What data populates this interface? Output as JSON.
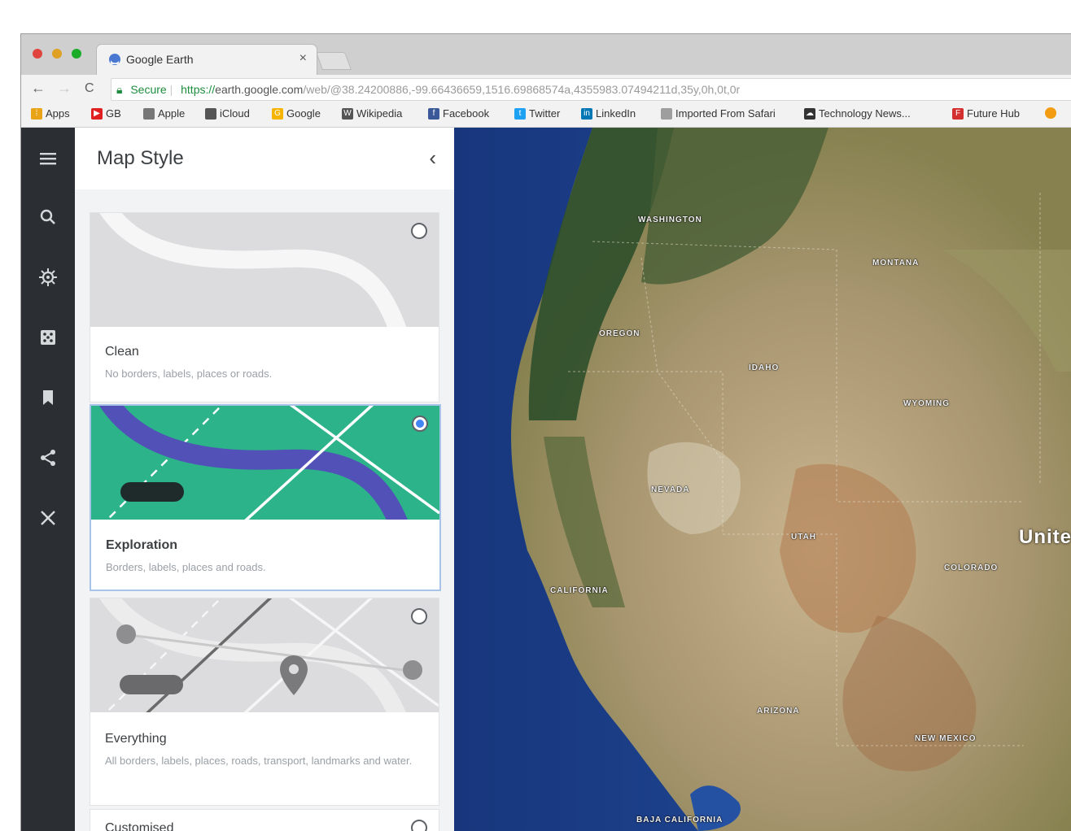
{
  "browser": {
    "tab_title": "Google Earth",
    "tab_close": "×",
    "secure_label": "Secure",
    "url_scheme": "https://",
    "url_host": "earth.google.com",
    "url_path": "/web/@38.24200886,-99.66436659,1516.69868574a,4355983.07494211d,35y,0h,0t,0r",
    "nav": {
      "back": "←",
      "forward": "→",
      "reload": "C"
    }
  },
  "bookmarks": [
    {
      "label": "Apps",
      "icon": "apps-grid-icon",
      "color": "#e8a317"
    },
    {
      "label": "GB",
      "icon": "youtube-icon",
      "color": "#e02020"
    },
    {
      "label": "Apple",
      "icon": "apple-icon",
      "color": "#777777"
    },
    {
      "label": "iCloud",
      "icon": "apple-icon",
      "color": "#555555"
    },
    {
      "label": "Google",
      "icon": "google-icon",
      "color": "#f4b400"
    },
    {
      "label": "Wikipedia",
      "icon": "wikipedia-icon",
      "color": "#555555"
    },
    {
      "label": "Facebook",
      "icon": "facebook-icon",
      "color": "#3b5998"
    },
    {
      "label": "Twitter",
      "icon": "twitter-icon",
      "color": "#1da1f2"
    },
    {
      "label": "LinkedIn",
      "icon": "linkedin-icon",
      "color": "#0077b5"
    },
    {
      "label": "Imported From Safari",
      "icon": "folder-icon",
      "color": "#9e9e9e"
    },
    {
      "label": "Technology News...",
      "icon": "cloud-icon",
      "color": "#333333"
    },
    {
      "label": "Future Hub",
      "icon": "future-icon",
      "color": "#d32f2f"
    }
  ],
  "rail": {
    "icons": [
      "menu-icon",
      "search-icon",
      "voyager-icon",
      "feeling-lucky-icon",
      "bookmark-icon",
      "share-icon",
      "measure-icon"
    ]
  },
  "panel": {
    "title": "Map Style",
    "collapse_glyph": "‹",
    "styles": [
      {
        "name": "Clean",
        "description": "No borders, labels, places or roads.",
        "selected": false
      },
      {
        "name": "Exploration",
        "description": "Borders, labels, places and roads.",
        "selected": true
      },
      {
        "name": "Everything",
        "description": "All borders, labels, places, roads, transport, landmarks and water.",
        "selected": false
      },
      {
        "name": "Customised",
        "description": "",
        "selected": false
      }
    ]
  },
  "map": {
    "labels": [
      "WASHINGTON",
      "MONTANA",
      "OREGON",
      "IDAHO",
      "WYOMING",
      "NEVADA",
      "UTAH",
      "COLORADO",
      "CALIFORNIA",
      "ARIZONA",
      "NEW MEXICO",
      "BAJA CALIFORNIA"
    ],
    "country_label": "Unite"
  },
  "colors": {
    "rail": "#2b2f33",
    "exploration_green": "#2db38a",
    "exploration_road": "#5151b8",
    "ocean": "#1d3f8c"
  }
}
